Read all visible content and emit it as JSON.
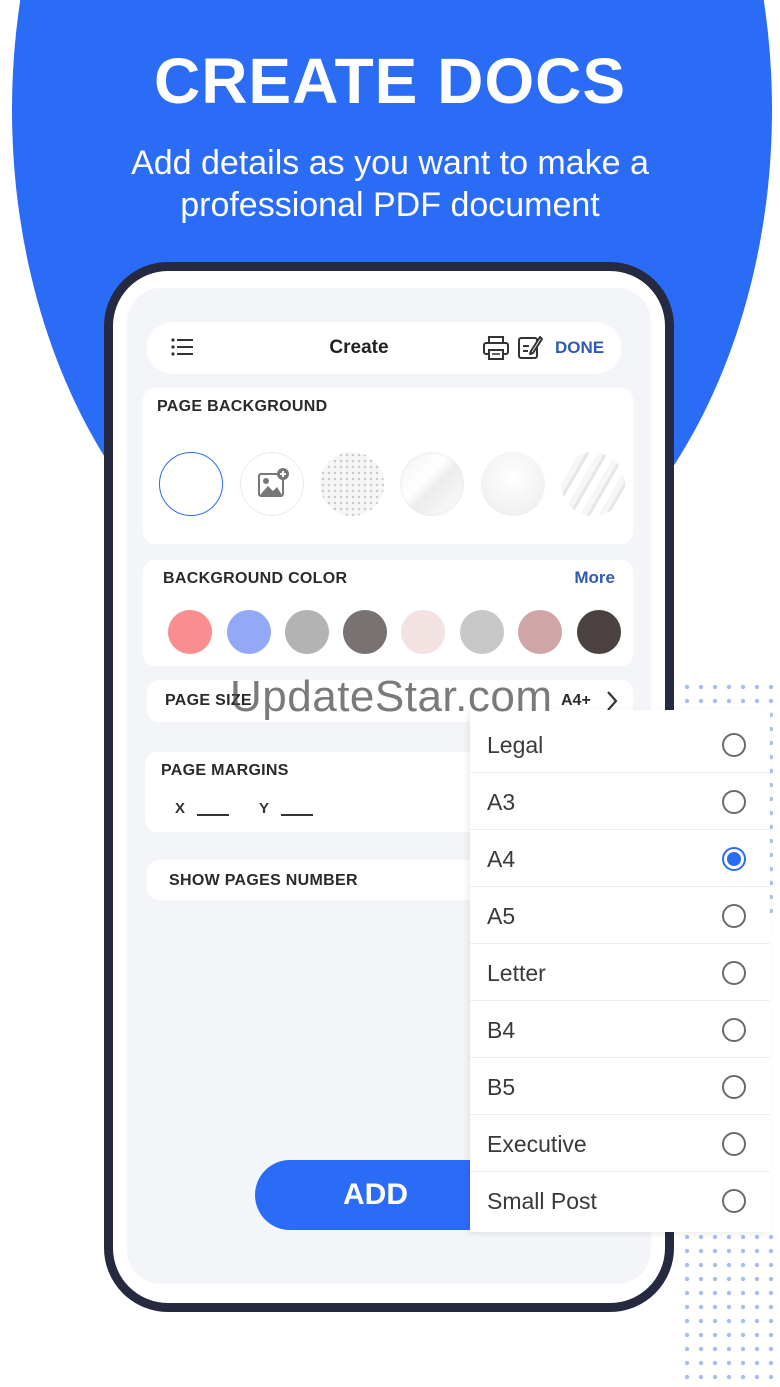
{
  "hero": {
    "title": "CREATE DOCS",
    "subtitle_line1": "Add details as you want to make a",
    "subtitle_line2": "professional PDF document"
  },
  "topbar": {
    "title": "Create",
    "done_label": "DONE",
    "icons": [
      "menu-icon",
      "print-icon",
      "edit-icon"
    ]
  },
  "page_background": {
    "label": "PAGE BACKGROUND",
    "options": [
      "white",
      "add-image",
      "dotted",
      "marble",
      "soft-gray",
      "brush"
    ]
  },
  "background_color": {
    "label": "BACKGROUND COLOR",
    "more_label": "More",
    "swatches": [
      "#fa8d8f",
      "#93a9f7",
      "#b3b3b3",
      "#787372",
      "#f2e2e2",
      "#c7c7c7",
      "#d0a5a5",
      "#4b4140"
    ]
  },
  "page_size": {
    "label": "PAGE SIZE",
    "value": "A4+"
  },
  "page_margins": {
    "label": "PAGE MARGINS",
    "x_label": "X",
    "y_label": "Y"
  },
  "show_pages_number": {
    "label": "SHOW PAGES NUMBER"
  },
  "add_button": {
    "label": "ADD"
  },
  "size_dropdown": {
    "items": [
      {
        "label": "Legal",
        "selected": false
      },
      {
        "label": "A3",
        "selected": false
      },
      {
        "label": "A4",
        "selected": true
      },
      {
        "label": "A5",
        "selected": false
      },
      {
        "label": "Letter",
        "selected": false
      },
      {
        "label": "B4",
        "selected": false
      },
      {
        "label": "B5",
        "selected": false
      },
      {
        "label": "Executive",
        "selected": false
      },
      {
        "label": "Small Post",
        "selected": false
      }
    ]
  },
  "watermark": "UpdateStar.com",
  "colors": {
    "accent": "#2b6cf6",
    "link": "#2f5bb3",
    "phone_frame": "#262a40"
  }
}
